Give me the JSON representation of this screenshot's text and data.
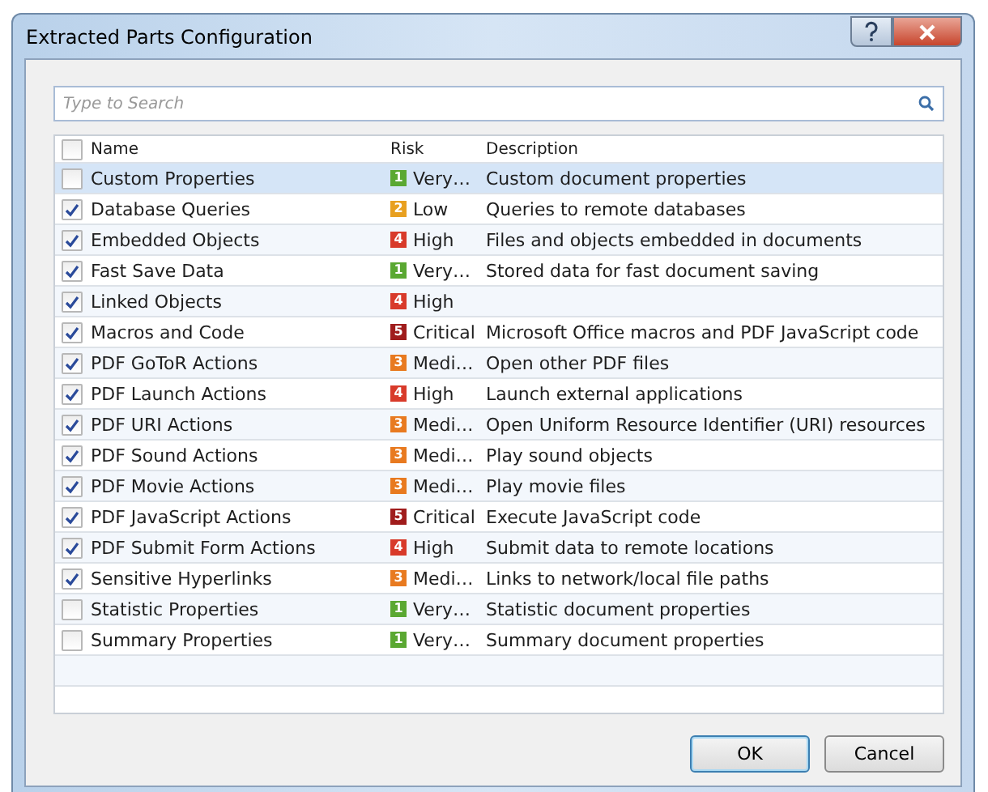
{
  "window": {
    "title": "Extracted Parts Configuration"
  },
  "search": {
    "placeholder": "Type to Search"
  },
  "table": {
    "all_checked": false,
    "columns": [
      "Name",
      "Risk",
      "Description"
    ],
    "rows": [
      {
        "name": "Custom Properties",
        "checked": false,
        "selected": true,
        "risk": {
          "badge": "1",
          "label": "Very…",
          "color": "#5aa832"
        },
        "description": "Custom document properties"
      },
      {
        "name": "Database Queries",
        "checked": true,
        "selected": false,
        "risk": {
          "badge": "2",
          "label": "Low",
          "color": "#e8a020"
        },
        "description": "Queries to remote databases"
      },
      {
        "name": "Embedded Objects",
        "checked": true,
        "selected": false,
        "risk": {
          "badge": "4",
          "label": "High",
          "color": "#d83a2a"
        },
        "description": "Files and objects embedded in documents"
      },
      {
        "name": "Fast Save Data",
        "checked": true,
        "selected": false,
        "risk": {
          "badge": "1",
          "label": "Very…",
          "color": "#5aa832"
        },
        "description": "Stored data for fast document saving"
      },
      {
        "name": "Linked Objects",
        "checked": true,
        "selected": false,
        "risk": {
          "badge": "4",
          "label": "High",
          "color": "#d83a2a"
        },
        "description": ""
      },
      {
        "name": "Macros and Code",
        "checked": true,
        "selected": false,
        "risk": {
          "badge": "5",
          "label": "Critical",
          "color": "#a01c1c"
        },
        "description": "Microsoft Office macros and PDF JavaScript code"
      },
      {
        "name": "PDF GoToR Actions",
        "checked": true,
        "selected": false,
        "risk": {
          "badge": "3",
          "label": "Medi…",
          "color": "#e87a20"
        },
        "description": "Open other PDF files"
      },
      {
        "name": "PDF Launch Actions",
        "checked": true,
        "selected": false,
        "risk": {
          "badge": "4",
          "label": "High",
          "color": "#d83a2a"
        },
        "description": "Launch external applications"
      },
      {
        "name": "PDF URI Actions",
        "checked": true,
        "selected": false,
        "risk": {
          "badge": "3",
          "label": "Medi…",
          "color": "#e87a20"
        },
        "description": "Open Uniform Resource Identifier (URI) resources"
      },
      {
        "name": "PDF Sound Actions",
        "checked": true,
        "selected": false,
        "risk": {
          "badge": "3",
          "label": "Medi…",
          "color": "#e87a20"
        },
        "description": "Play sound objects"
      },
      {
        "name": "PDF Movie Actions",
        "checked": true,
        "selected": false,
        "risk": {
          "badge": "3",
          "label": "Medi…",
          "color": "#e87a20"
        },
        "description": "Play movie files"
      },
      {
        "name": "PDF JavaScript Actions",
        "checked": true,
        "selected": false,
        "risk": {
          "badge": "5",
          "label": "Critical",
          "color": "#a01c1c"
        },
        "description": "Execute JavaScript code"
      },
      {
        "name": "PDF Submit Form Actions",
        "checked": true,
        "selected": false,
        "risk": {
          "badge": "4",
          "label": "High",
          "color": "#d83a2a"
        },
        "description": "Submit data to remote locations"
      },
      {
        "name": "Sensitive Hyperlinks",
        "checked": true,
        "selected": false,
        "risk": {
          "badge": "3",
          "label": "Medi…",
          "color": "#e87a20"
        },
        "description": "Links to network/local file paths"
      },
      {
        "name": "Statistic Properties",
        "checked": false,
        "selected": false,
        "risk": {
          "badge": "1",
          "label": "Very…",
          "color": "#5aa832"
        },
        "description": "Statistic document properties"
      },
      {
        "name": "Summary Properties",
        "checked": false,
        "selected": false,
        "risk": {
          "badge": "1",
          "label": "Very…",
          "color": "#5aa832"
        },
        "description": "Summary document properties"
      }
    ]
  },
  "buttons": [
    {
      "label": "OK",
      "default": true
    },
    {
      "label": "Cancel",
      "default": false
    }
  ]
}
